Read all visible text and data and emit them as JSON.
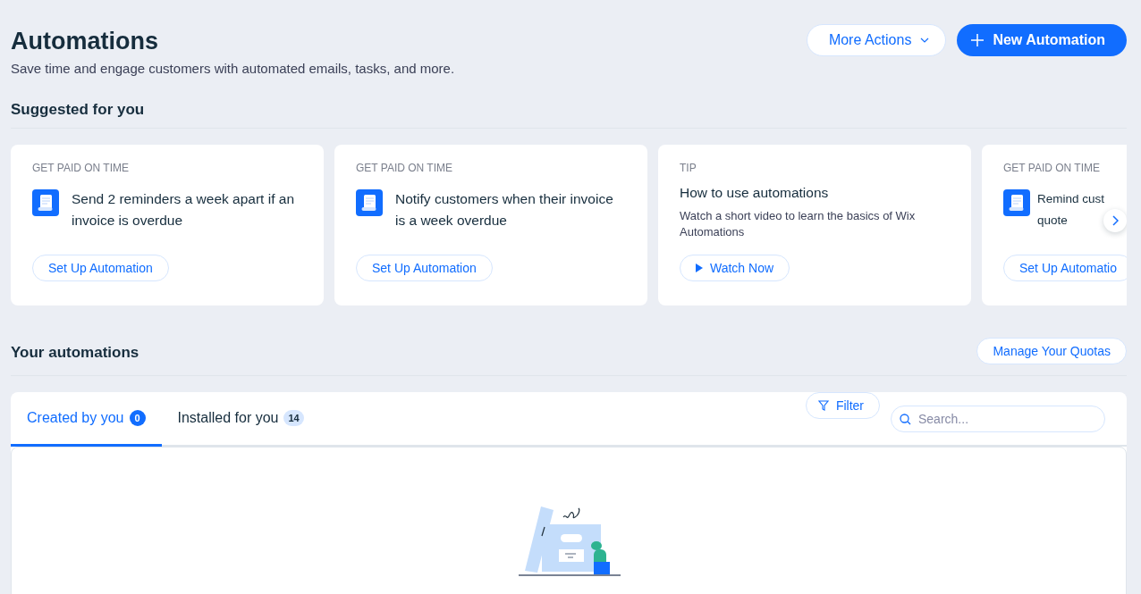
{
  "header": {
    "title": "Automations",
    "subtitle": "Save time and engage customers with automated emails, tasks, and more.",
    "more_actions": "More Actions",
    "new_button": "New Automation"
  },
  "suggested": {
    "title": "Suggested for you",
    "cards": [
      {
        "kind": "automation",
        "category": "GET PAID ON TIME",
        "title": "Send 2 reminders a week apart if an invoice is overdue",
        "action": "Set Up Automation"
      },
      {
        "kind": "automation",
        "category": "GET PAID ON TIME",
        "title": "Notify customers when their invoice is a week overdue",
        "action": "Set Up Automation"
      },
      {
        "kind": "tip",
        "category": "TIP",
        "title": "How to use automations",
        "description": "Watch a short video to learn the basics of Wix Automations",
        "action": "Watch Now"
      },
      {
        "kind": "automation",
        "category": "GET PAID ON TIME",
        "title": "Remind cust quote",
        "action": "Set Up Automatio"
      }
    ]
  },
  "yours": {
    "title": "Your automations",
    "quotas_button": "Manage Your Quotas",
    "tabs": [
      {
        "label": "Created by you",
        "count": "0",
        "selected": true
      },
      {
        "label": "Installed for you",
        "count": "14",
        "selected": false
      }
    ],
    "filter": "Filter",
    "search": {
      "placeholder": "Search..."
    }
  }
}
